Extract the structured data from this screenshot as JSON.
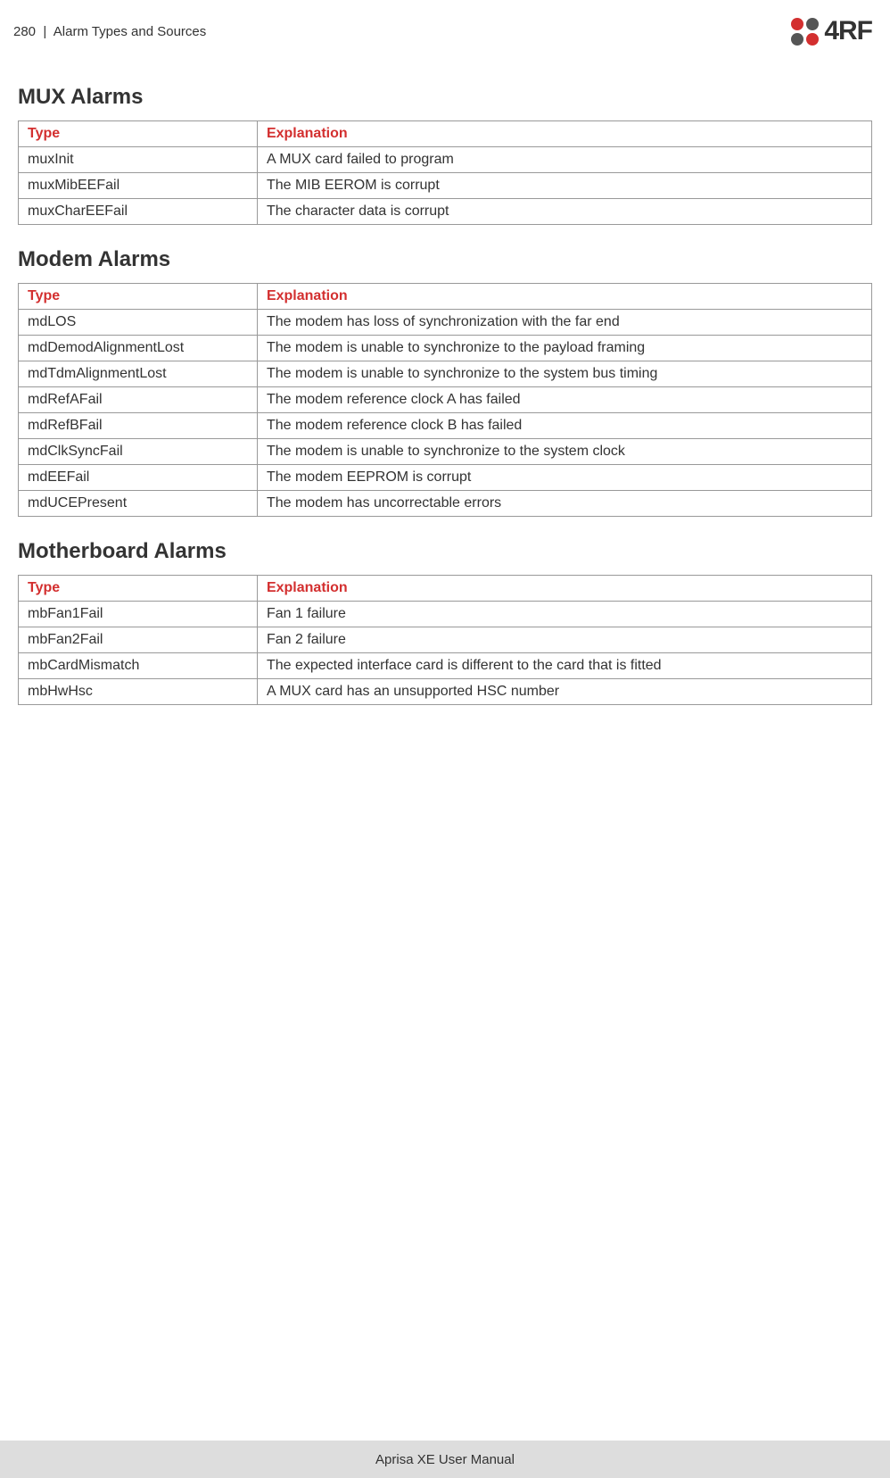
{
  "header": {
    "page_number": "280",
    "separator": "|",
    "section_name": "Alarm Types and Sources",
    "logo_text": "4RF"
  },
  "sections": {
    "mux": {
      "title": "MUX Alarms",
      "headers": {
        "type": "Type",
        "explanation": "Explanation"
      },
      "rows": [
        {
          "type": "muxInit",
          "explanation": "A MUX card failed to program"
        },
        {
          "type": "muxMibEEFail",
          "explanation": "The MIB EEROM is corrupt"
        },
        {
          "type": "muxCharEEFail",
          "explanation": "The character data is corrupt"
        }
      ]
    },
    "modem": {
      "title": "Modem Alarms",
      "headers": {
        "type": "Type",
        "explanation": "Explanation"
      },
      "rows": [
        {
          "type": "mdLOS",
          "explanation": "The modem has loss of synchronization with the far end"
        },
        {
          "type": "mdDemodAlignmentLost",
          "explanation": "The modem is unable to synchronize to the payload framing"
        },
        {
          "type": "mdTdmAlignmentLost",
          "explanation": "The modem is unable to synchronize to the system bus timing"
        },
        {
          "type": "mdRefAFail",
          "explanation": "The modem reference clock A has failed"
        },
        {
          "type": "mdRefBFail",
          "explanation": "The modem reference clock B has failed"
        },
        {
          "type": "mdClkSyncFail",
          "explanation": "The modem is unable to synchronize to the system clock"
        },
        {
          "type": "mdEEFail",
          "explanation": "The modem EEPROM is corrupt"
        },
        {
          "type": "mdUCEPresent",
          "explanation": "The modem has uncorrectable errors"
        }
      ]
    },
    "motherboard": {
      "title": "Motherboard Alarms",
      "headers": {
        "type": "Type",
        "explanation": "Explanation"
      },
      "rows": [
        {
          "type": "mbFan1Fail",
          "explanation": "Fan 1 failure"
        },
        {
          "type": "mbFan2Fail",
          "explanation": "Fan 2 failure"
        },
        {
          "type": "mbCardMismatch",
          "explanation": "The expected interface card is different to the card that is fitted"
        },
        {
          "type": "mbHwHsc",
          "explanation": "A MUX card has an unsupported HSC number"
        }
      ]
    }
  },
  "footer": {
    "text": "Aprisa XE User Manual"
  }
}
